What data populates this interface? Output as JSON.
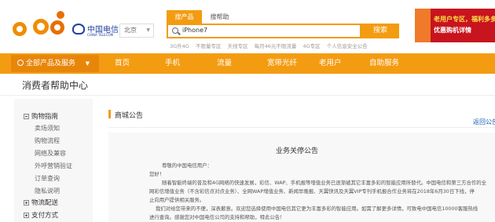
{
  "header": {
    "logo_text": "欢go",
    "telecom_cn": "中国电信",
    "telecom_en": "CHINA TELECOM",
    "city": "北京",
    "search_tabs": [
      "搜产品",
      "搜帮助"
    ],
    "search_value": "iPhone7",
    "search_button": "搜索",
    "hot_keywords": [
      "3G升4G",
      "不限量专区",
      "天线专区",
      "每月46元不限流量",
      "4G专区",
      "个人信息安全公告"
    ],
    "banner_line1": "老用户专区，福利多多",
    "banner_line2": "优惠购机详情"
  },
  "nav": {
    "all_products": "全部产品及服务",
    "items": [
      "首页",
      "手机",
      "流量",
      "宽带光纤",
      "老用户",
      "自助服务"
    ]
  },
  "page_title": "消费者帮助中心",
  "sidebar": {
    "groups": [
      {
        "label": "购物指南",
        "expanded": true,
        "items": [
          "卖场须知",
          "购物流程",
          "网络及兼容",
          "外呼营销验证",
          "订单查询",
          "隐私说明"
        ]
      },
      {
        "label": "物流配送",
        "expanded": false,
        "items": []
      },
      {
        "label": "支付方式",
        "expanded": false,
        "items": []
      }
    ]
  },
  "content": {
    "section_title": "商城公告",
    "back_link": "返回公告列表",
    "notice_title": "业务关停公告",
    "lines": [
      "尊敬的中国电信用户：",
      "您好！",
      "随着智能终端的普及和4G网络的快速发展，彩信、WAP、手机报等增值业务已逐渐被其它丰富多彩的智能应用所替代。中国电信和第三方合作的全",
      "网彩信增值业务（不含彩信点对点业务）、全网WAP增值业务、新闻早晚报、天翼快讯及天翼VIP专刊手机报合作业务将在2018年6月30日下线，停",
      "止向用户提供相关服务。",
      "我们对给您带来的不便，深表歉意。欢迎您选择使用中国电信其它更为丰富多彩的智能应用。如需了解更多详情，可致电中国电信10000客服热线",
      "进行查询。感谢您对中国电信公司的支持和帮助，特此公告！"
    ]
  }
}
